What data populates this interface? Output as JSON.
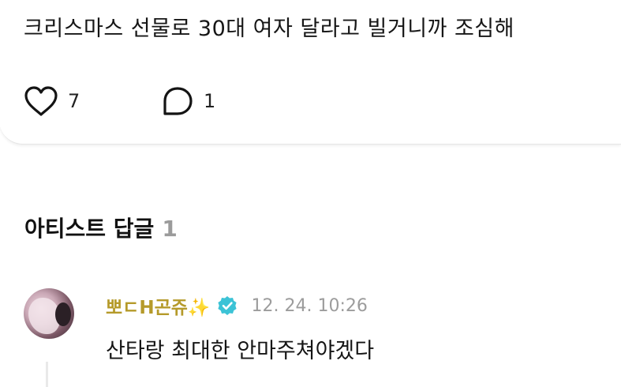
{
  "post": {
    "text": "크리스마스 선물로 30대 여자 달라고 빌거니까 조심해",
    "likes_count": "7",
    "comments_count": "1"
  },
  "replies_section": {
    "title": "아티스트 답글",
    "count": "1"
  },
  "reply": {
    "author_name": "뽀ㄷH곤쥬✨",
    "timestamp": "12. 24. 10:26",
    "text": "산타랑 최대한 안마주쳐야겠다"
  },
  "icons": {
    "like": "heart-outline-icon",
    "comment": "speech-bubble-icon",
    "verified": "verified-badge-icon"
  },
  "colors": {
    "author_name": "#b59a2a",
    "verified_badge": "#3cc3d6",
    "count_muted": "#9b9b9b",
    "timestamp": "#9c9c9c"
  }
}
